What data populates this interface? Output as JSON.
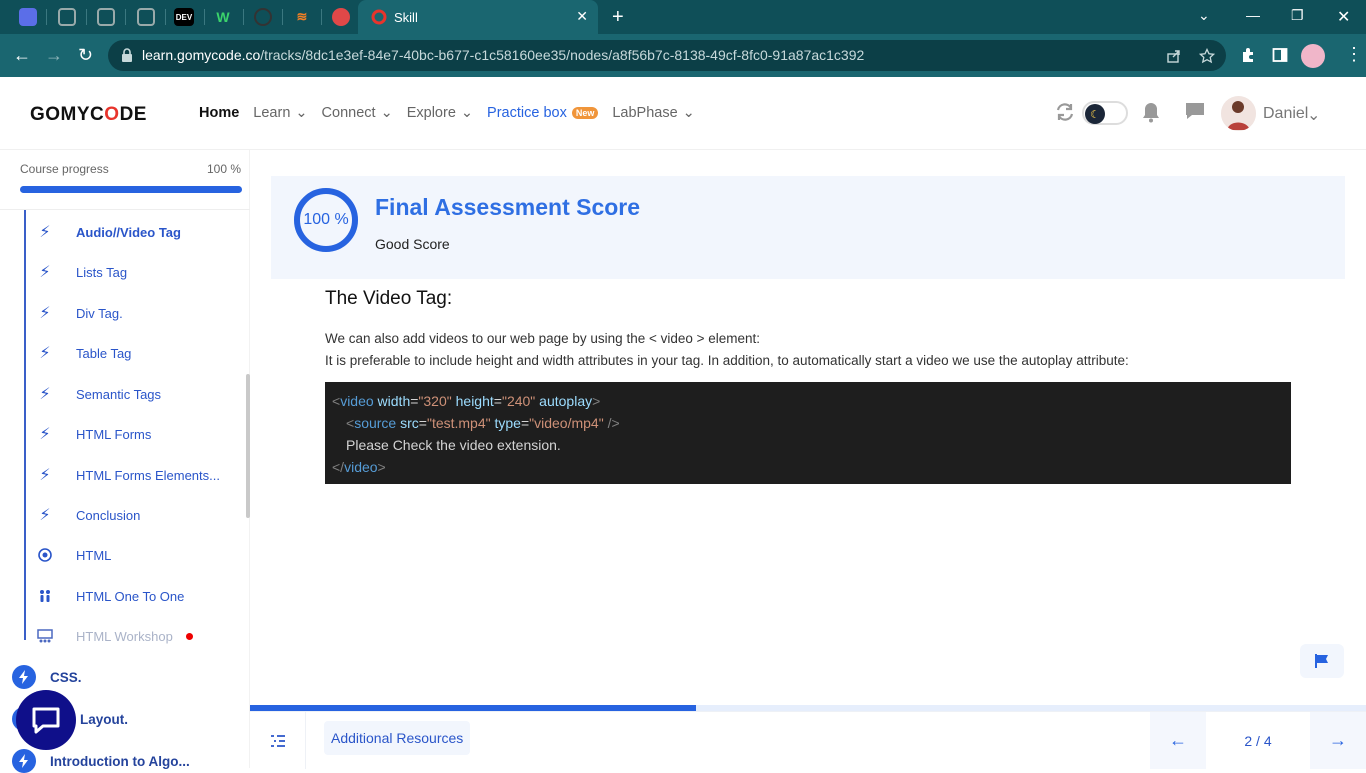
{
  "browser": {
    "active_tab_title": "Skill",
    "url_domain": "learn.gomycode.co",
    "url_path": "/tracks/8dc1e3ef-84e7-40bc-b677-c1c58160ee35/nodes/a8f56b7c-8138-49cf-8fc0-91a87ac1c392",
    "tab_favicons": [
      "app-icon",
      "globe-icon",
      "globe-icon",
      "globe-icon",
      "DEV",
      "W",
      "circle-icon",
      "stack-icon",
      "shield-icon"
    ]
  },
  "header": {
    "logo_pre": "GOMYC",
    "logo_o": "O",
    "logo_post": "DE",
    "nav": {
      "home": "Home",
      "learn": "Learn",
      "connect": "Connect",
      "explore": "Explore",
      "practice": "Practice box",
      "practice_badge": "New",
      "labphase": "LabPhase"
    },
    "user_name": "Daniel"
  },
  "sidebar": {
    "progress_label": "Course progress",
    "progress_value": "100 %",
    "progress_fraction": 1.0,
    "items": [
      {
        "label": "Audio//Video Tag",
        "icon": "bolt-icon",
        "state": "current"
      },
      {
        "label": "Lists Tag",
        "icon": "bolt-icon",
        "state": "normal"
      },
      {
        "label": "Div Tag.",
        "icon": "bolt-icon",
        "state": "normal"
      },
      {
        "label": "Table Tag",
        "icon": "bolt-icon",
        "state": "normal"
      },
      {
        "label": "Semantic Tags",
        "icon": "bolt-icon",
        "state": "normal"
      },
      {
        "label": "HTML Forms",
        "icon": "bolt-icon",
        "state": "normal"
      },
      {
        "label": "HTML Forms Elements...",
        "icon": "bolt-icon",
        "state": "normal"
      },
      {
        "label": "Conclusion",
        "icon": "bolt-icon",
        "state": "normal"
      },
      {
        "label": "HTML",
        "icon": "target-icon",
        "state": "normal"
      },
      {
        "label": "HTML One To One",
        "icon": "people-icon",
        "state": "normal"
      },
      {
        "label": "HTML Workshop",
        "icon": "workshop-icon",
        "state": "dim"
      }
    ],
    "chapters": [
      {
        "label": "CSS."
      },
      {
        "label": "Layout."
      },
      {
        "label": "Introduction to Algo..."
      }
    ]
  },
  "score": {
    "percent_text": "100 %",
    "percent_value": 100,
    "title": "Final Assessment Score",
    "subtitle": "Good Score"
  },
  "lesson": {
    "heading": "The Video Tag:",
    "para1": "We can also add videos to our web page by using the < video > element:",
    "para2": "It is preferable to include height and width attributes in your tag. In addition, to automatically start a video we use the autoplay attribute:",
    "code": {
      "line1": {
        "open": "<",
        "tag": "video",
        "attr1": " width",
        "eq1": "=",
        "val1": "\"320\"",
        "attr2": " height",
        "eq2": "=",
        "val2": "\"240\"",
        "attr3": " autoplay",
        "close": ">"
      },
      "line2": {
        "open": "<",
        "tag": "source",
        "attr1": " src",
        "eq1": "=",
        "val1": "\"test.mp4\"",
        "attr2": " type",
        "eq2": "=",
        "val2": "\"video/mp4\"",
        "close": " />"
      },
      "line3": "Please Check the video extension.",
      "line4": {
        "open": "</",
        "tag": "video",
        "close": ">"
      }
    }
  },
  "footer": {
    "resources_label": "Additional Resources",
    "page_indicator": "2 / 4",
    "page_progress_fraction": 0.4,
    "prev_arrow": "←",
    "next_arrow": "→"
  },
  "colors": {
    "accent": "#2763e0",
    "tab_bar": "#0f4f58",
    "code_bg": "#1e1e1e"
  }
}
